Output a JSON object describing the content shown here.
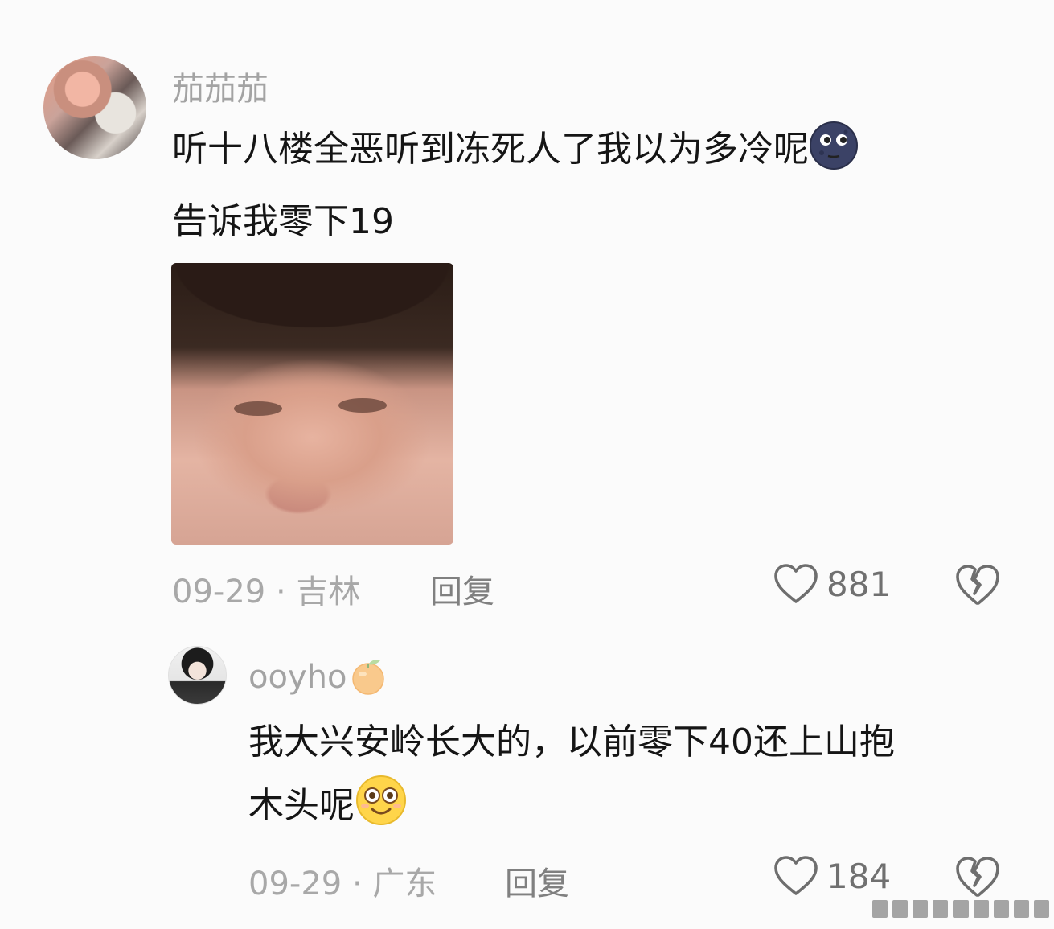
{
  "comments": [
    {
      "username": "茄茄茄",
      "text_line1": "听十八楼全恶听到冻死人了我以为多冷呢",
      "text_line2": "告诉我零下19",
      "emoji": "new-moon-face-icon",
      "date": "09-29",
      "location": "吉林",
      "reply_label": "回复",
      "likes": "881"
    },
    {
      "username": "ooyho",
      "username_badge": "tangerine-icon",
      "text_line1": "我大兴安岭长大的，以前零下40还上山抱",
      "text_line2": "木头呢",
      "emoji": "flushed-smile-icon",
      "date": "09-29",
      "location": "广东",
      "reply_label": "回复",
      "likes": "184"
    }
  ],
  "meta_separator": "·",
  "colors": {
    "background": "#fbfbfb",
    "username": "#a3a3a3",
    "meta": "#a8a8a8",
    "icon": "#707070"
  }
}
